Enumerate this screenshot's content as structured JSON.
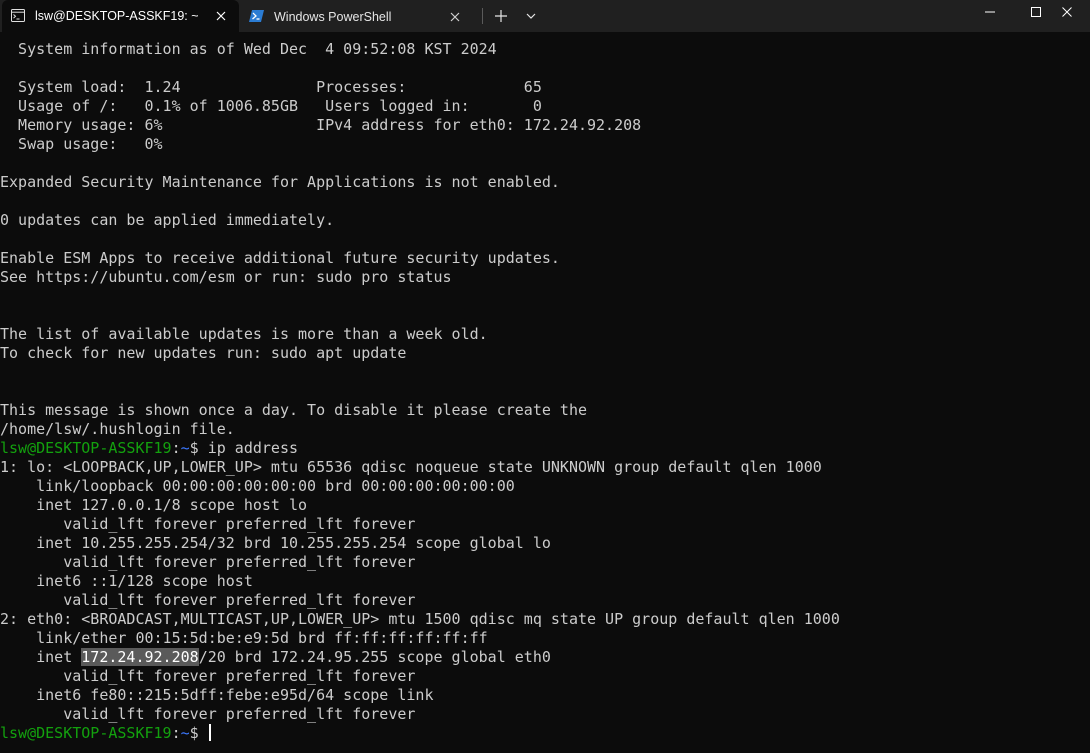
{
  "tabs": [
    {
      "title": "lsw@DESKTOP-ASSKF19: ~",
      "icon": "linux-terminal-icon",
      "active": true
    },
    {
      "title": "Windows PowerShell",
      "icon": "powershell-icon",
      "active": false
    }
  ],
  "window_controls": {
    "new_tab": "+",
    "dropdown": "⌄",
    "minimize": "—",
    "maximize": "☐",
    "close": "✕"
  },
  "colors": {
    "background": "#0c0c0c",
    "text": "#cccccc",
    "prompt_user": "#13a10e",
    "prompt_path": "#3b78ff",
    "selection": "#5a5a5a",
    "tabbar": "#202020",
    "powershell_icon": "#2b7cd3"
  },
  "terminal": {
    "lines": [
      "  System information as of Wed Dec  4 09:52:08 KST 2024",
      "",
      "  System load:  1.24               Processes:             65",
      "  Usage of /:   0.1% of 1006.85GB   Users logged in:       0",
      "  Memory usage: 6%                 IPv4 address for eth0: 172.24.92.208",
      "  Swap usage:   0%",
      "",
      "Expanded Security Maintenance for Applications is not enabled.",
      "",
      "0 updates can be applied immediately.",
      "",
      "Enable ESM Apps to receive additional future security updates.",
      "See https://ubuntu.com/esm or run: sudo pro status",
      "",
      "",
      "The list of available updates is more than a week old.",
      "To check for new updates run: sudo apt update",
      "",
      "",
      "This message is shown once a day. To disable it please create the",
      "/home/lsw/.hushlogin file."
    ],
    "prompt": {
      "user_host": "lsw@DESKTOP-ASSKF19",
      "sep": ":",
      "path": "~",
      "symbol": "$ "
    },
    "command": "ip address",
    "output": [
      "1: lo: <LOOPBACK,UP,LOWER_UP> mtu 65536 qdisc noqueue state UNKNOWN group default qlen 1000",
      "    link/loopback 00:00:00:00:00:00 brd 00:00:00:00:00:00",
      "    inet 127.0.0.1/8 scope host lo",
      "       valid_lft forever preferred_lft forever",
      "    inet 10.255.255.254/32 brd 10.255.255.254 scope global lo",
      "       valid_lft forever preferred_lft forever",
      "    inet6 ::1/128 scope host",
      "       valid_lft forever preferred_lft forever",
      "2: eth0: <BROADCAST,MULTICAST,UP,LOWER_UP> mtu 1500 qdisc mq state UP group default qlen 1000",
      "    link/ether 00:15:5d:be:e9:5d brd ff:ff:ff:ff:ff:ff"
    ],
    "eth0_inet": {
      "prefix": "    inet ",
      "selected": "172.24.92.208",
      "suffix": "/20 brd 172.24.95.255 scope global eth0"
    },
    "output_tail": [
      "       valid_lft forever preferred_lft forever",
      "    inet6 fe80::215:5dff:febe:e95d/64 scope link",
      "       valid_lft forever preferred_lft forever"
    ]
  }
}
